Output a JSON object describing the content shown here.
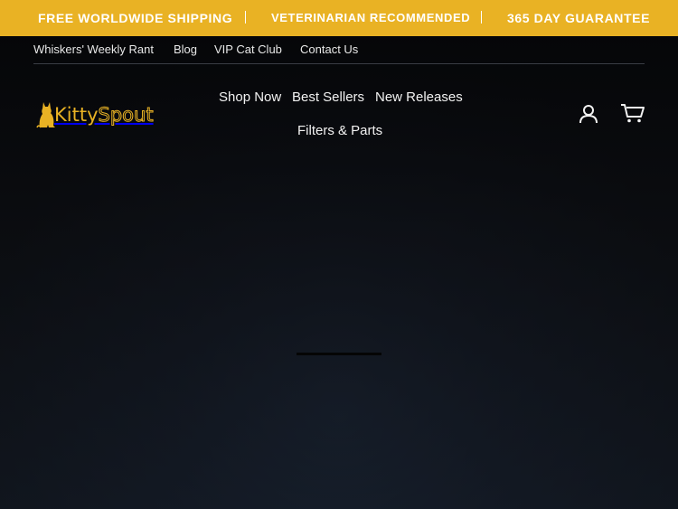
{
  "announcement": {
    "messages": [
      "FREE WORLDWIDE SHIPPING",
      "VETERINARIAN RECOMMENDED",
      "365 DAY GUARANTEE"
    ],
    "bg_color": "#e9b224"
  },
  "utility_nav": {
    "items": [
      "Whiskers' Weekly Rant",
      "Blog",
      "VIP Cat Club",
      "Contact Us"
    ]
  },
  "logo": {
    "part_a": "Kitty",
    "part_b": "Spout"
  },
  "main_nav": {
    "items": [
      "Shop Now",
      "Best Sellers",
      "New Releases",
      "Filters & Parts"
    ]
  },
  "header_icons": {
    "account": "user-icon",
    "cart": "cart-icon"
  }
}
